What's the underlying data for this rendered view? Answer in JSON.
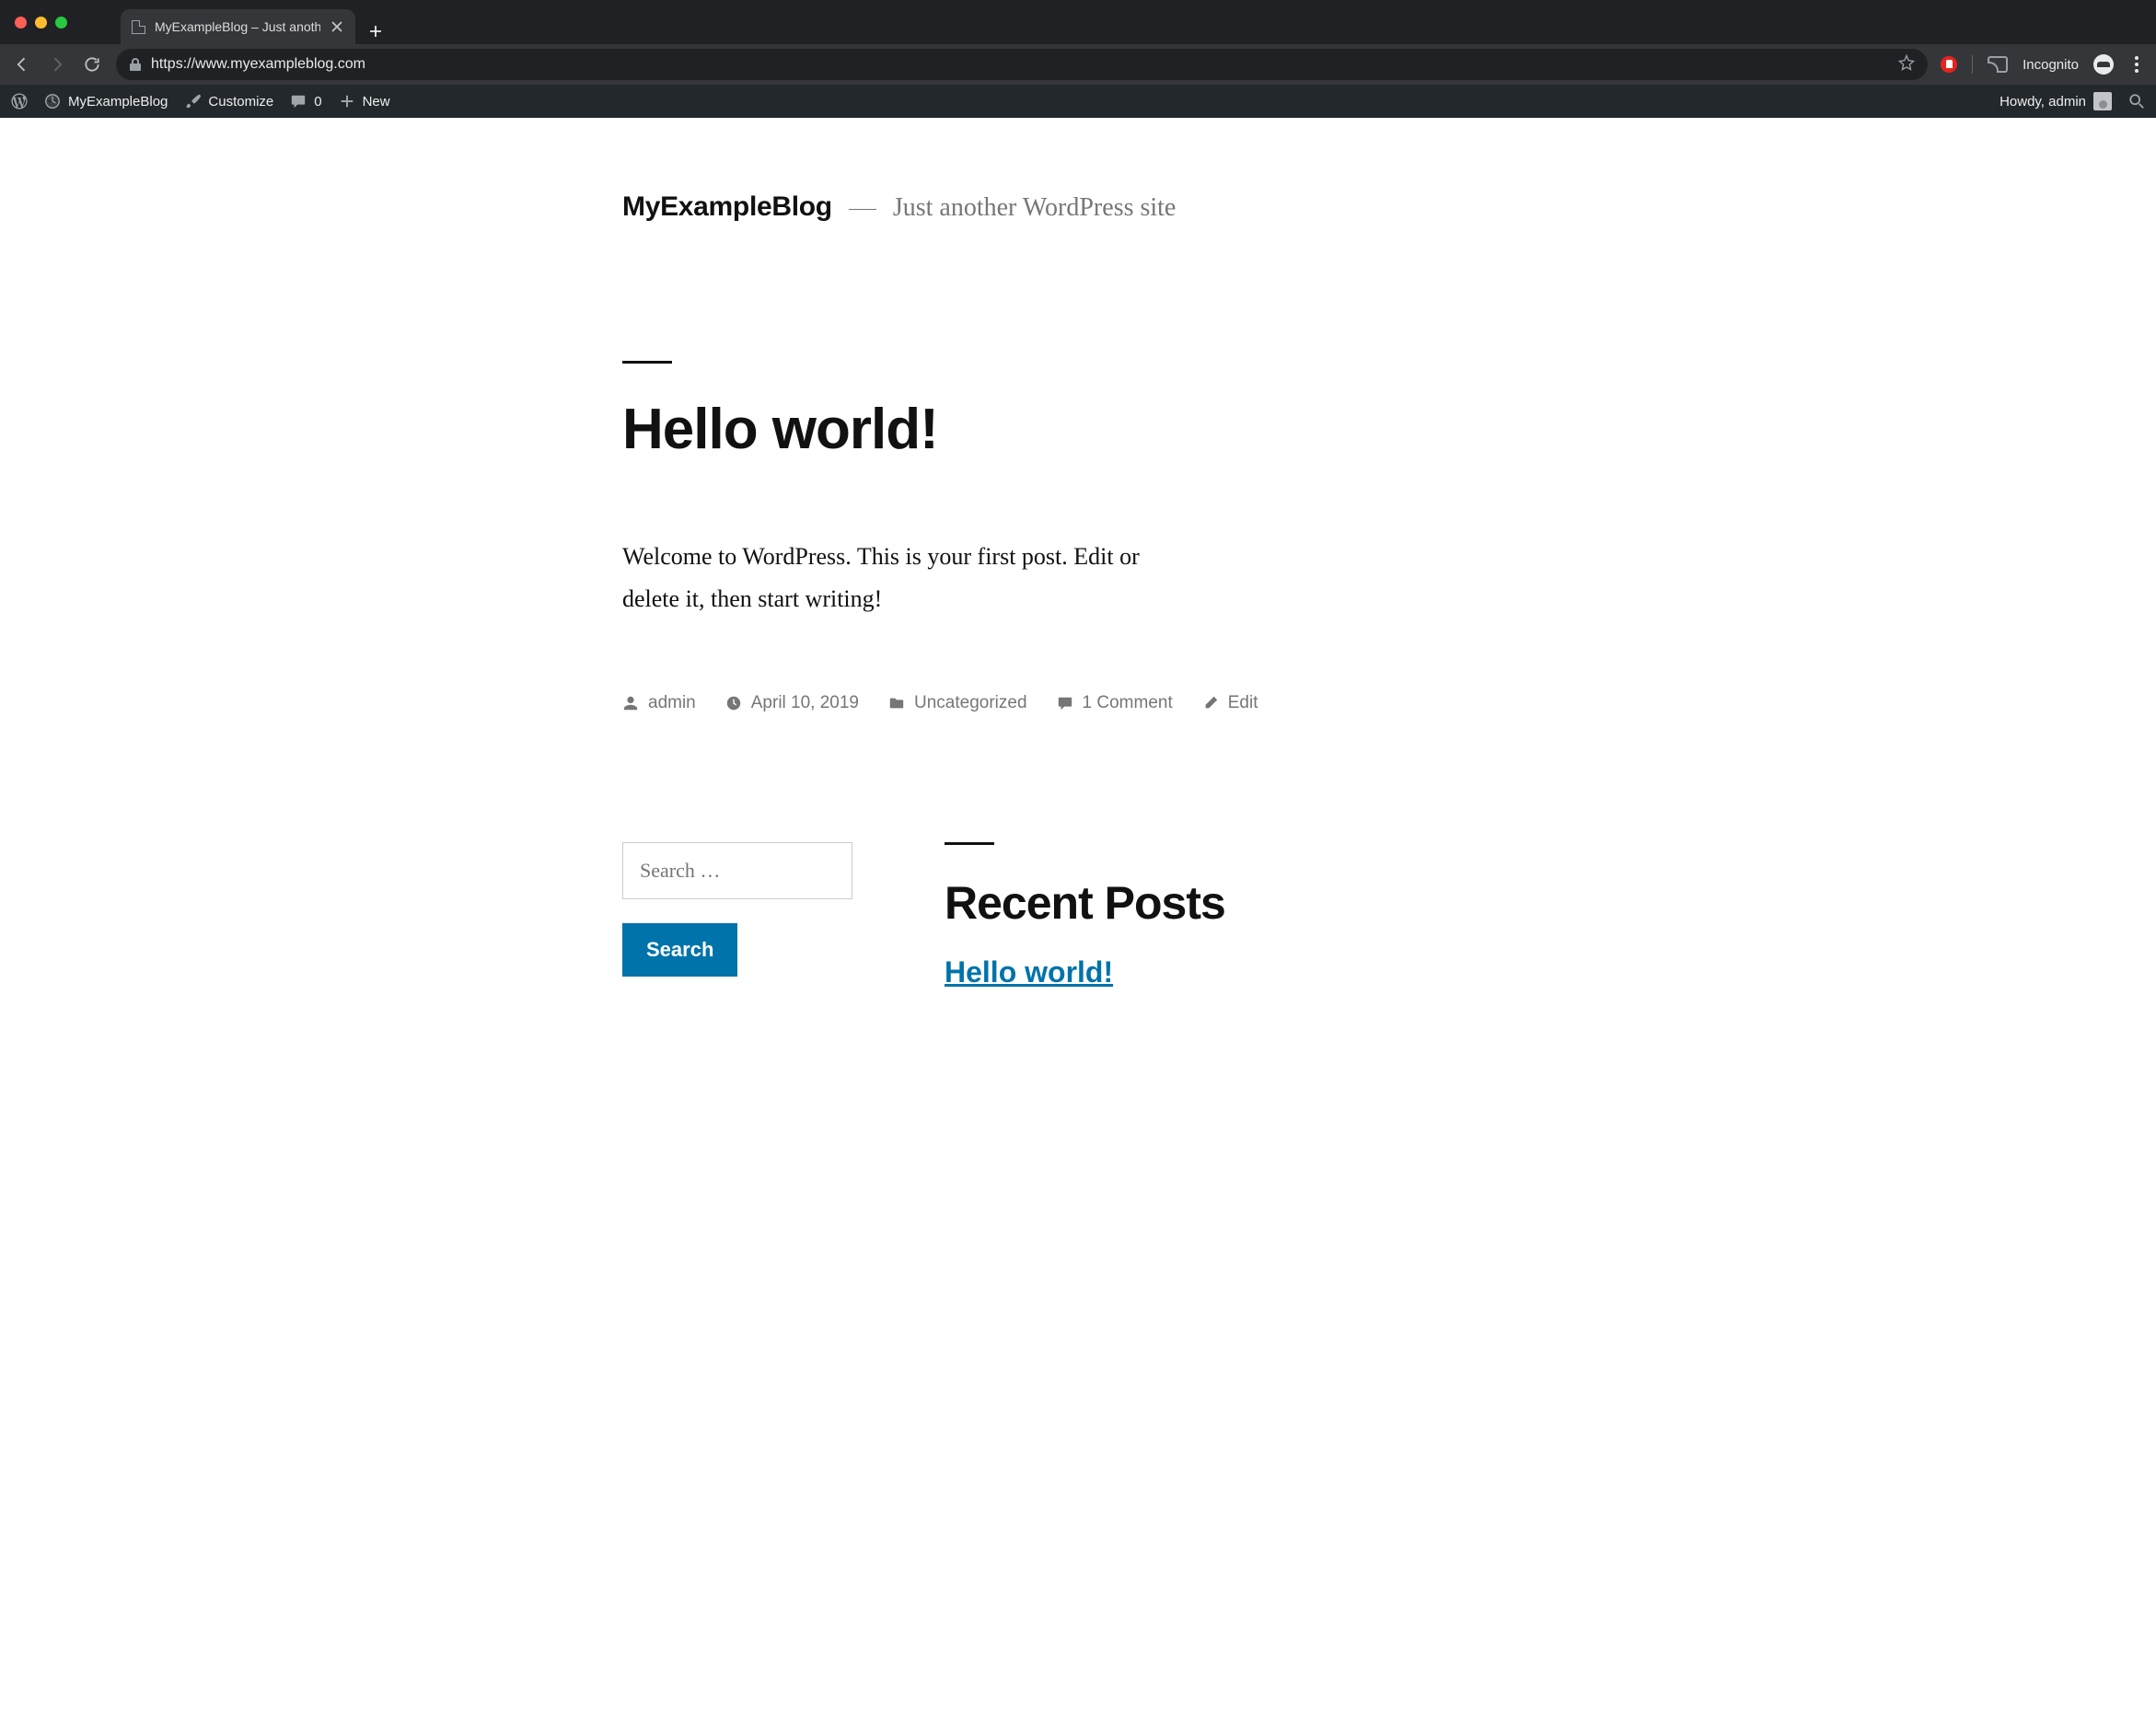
{
  "browser": {
    "tab_title": "MyExampleBlog – Just another",
    "url": "https://www.myexampleblog.com",
    "incognito_label": "Incognito"
  },
  "adminbar": {
    "site_name": "MyExampleBlog",
    "customize": "Customize",
    "comment_count": "0",
    "new_label": "New",
    "howdy": "Howdy, admin"
  },
  "site": {
    "title": "MyExampleBlog",
    "tagline": "Just another WordPress site"
  },
  "post": {
    "title": "Hello world!",
    "content": "Welcome to WordPress. This is your first post. Edit or delete it, then start writing!",
    "author": "admin",
    "date": "April 10, 2019",
    "category": "Uncategorized",
    "comments": "1 Comment",
    "edit": "Edit"
  },
  "widgets": {
    "search_placeholder": "Search …",
    "search_button": "Search",
    "recent_posts_title": "Recent Posts",
    "recent_post_link": "Hello world!"
  }
}
